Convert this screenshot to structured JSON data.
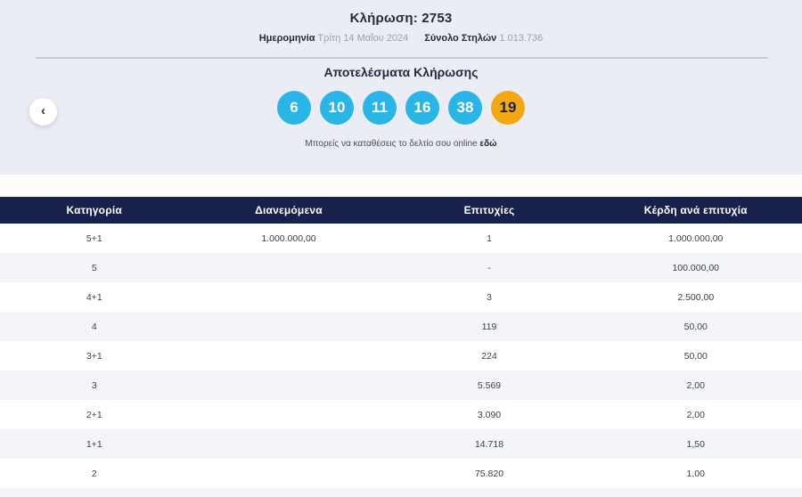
{
  "header": {
    "draw_title": "Κλήρωση: 2753",
    "date_label": "Ημερομηνία",
    "date_value": "Τρίτη 14 Μαΐου 2024",
    "columns_label": "Σύνολο Στηλών",
    "columns_value": "1.013.736"
  },
  "results": {
    "title": "Αποτελέσματα Κλήρωσης",
    "numbers": [
      "6",
      "10",
      "11",
      "16",
      "38"
    ],
    "joker": "19",
    "note_text": "Μπορείς να καταθέσεις το δελτίο σου online",
    "note_link": "εδώ"
  },
  "carousel": {
    "prev_icon": "‹"
  },
  "table": {
    "headers": [
      "Κατηγορία",
      "Διανεμόμενα",
      "Επιτυχίες",
      "Κέρδη ανά επιτυχία"
    ],
    "rows": [
      [
        "5+1",
        "1.000.000,00",
        "1",
        "1.000.000,00"
      ],
      [
        "5",
        "",
        "-",
        "100.000,00"
      ],
      [
        "4+1",
        "",
        "3",
        "2.500,00"
      ],
      [
        "4",
        "",
        "119",
        "50,00"
      ],
      [
        "3+1",
        "",
        "224",
        "50,00"
      ],
      [
        "3",
        "",
        "5.569",
        "2,00"
      ],
      [
        "2+1",
        "",
        "3.090",
        "2,00"
      ],
      [
        "1+1",
        "",
        "14.718",
        "1,50"
      ],
      [
        "2",
        "",
        "75.820",
        "1,00"
      ]
    ]
  },
  "colors": {
    "ball_blue": "#29b5e8",
    "ball_orange": "#f3a712",
    "header_navy": "#18204c",
    "section_bg": "#ebedf4",
    "row_alt": "#f4f5f8"
  }
}
